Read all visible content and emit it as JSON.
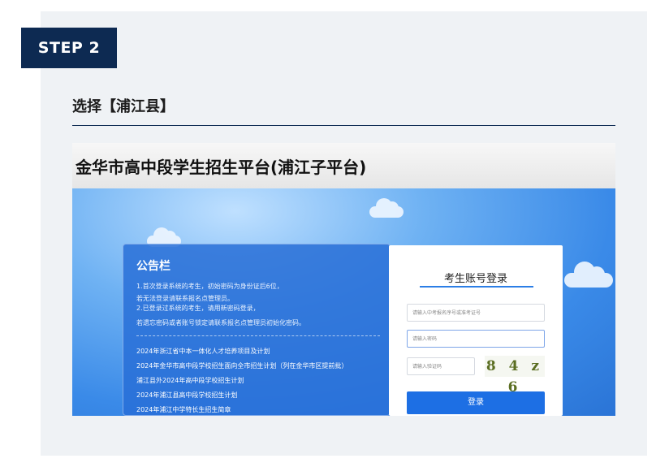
{
  "step_badge": "STEP 2",
  "section_title": "选择【浦江县】",
  "screenshot": {
    "page_title": "金华市高中段学生招生平台(浦江子平台)",
    "notice": {
      "title": "公告栏",
      "lines": [
        "1.首次登录系统的考生，初始密码为身份证后6位，",
        "若无法登录请联系报名点管理员。",
        "2.已登录过系统的考生，请用新密码登录，",
        "若遗忘密码或者账号锁定请联系报名点管理员初始化密码。"
      ],
      "links": [
        "2024年浙江省中本一体化人才培养项目及计划",
        "2024年金华市高中段学校招生面向全市招生计划（列在金华市区提前批）",
        "浦江县外2024年高中段学校招生计划",
        "2024年浦江县高中段学校招生计划",
        "2024年浦江中学特长生招生简章"
      ]
    },
    "login": {
      "title": "考生账号登录",
      "account_placeholder": "请输入中考报名序号或准考证号",
      "password_placeholder": "请输入密码",
      "captcha_placeholder": "请输入验证码",
      "captcha_text": "8 4 z 6",
      "button_label": "登录"
    }
  },
  "colors": {
    "badge_bg": "#0d2a52",
    "card_bg": "#eff2f5",
    "primary_blue": "#1d6fe4"
  }
}
